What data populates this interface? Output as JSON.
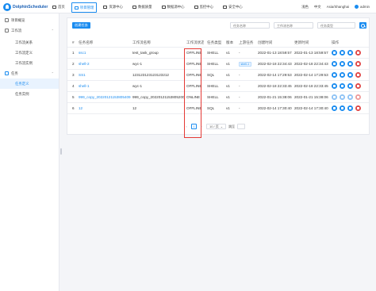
{
  "app": {
    "name": "DolphinScheduler"
  },
  "nav": [
    {
      "label": "首页",
      "active": false
    },
    {
      "label": "项目管理",
      "active": true
    },
    {
      "label": "资源中心",
      "active": false
    },
    {
      "label": "数据质量",
      "active": false
    },
    {
      "label": "数据源中心",
      "active": false
    },
    {
      "label": "监控中心",
      "active": false
    },
    {
      "label": "安全中心",
      "active": false
    }
  ],
  "header_right": {
    "theme": "浅色",
    "language": "中文",
    "timezone": "Asia/Shanghai",
    "user": "admin"
  },
  "sidebar": {
    "items": [
      {
        "label": "项目概览",
        "level": 0
      },
      {
        "label": "工作流",
        "level": 0,
        "expandable": true
      },
      {
        "label": "工作流关系",
        "level": 1
      },
      {
        "label": "工作流定义",
        "level": 1
      },
      {
        "label": "工作流实例",
        "level": 1
      },
      {
        "label": "任务",
        "level": 0,
        "expandable": true,
        "open": true
      },
      {
        "label": "任务定义",
        "level": 1,
        "active": true
      },
      {
        "label": "任务实例",
        "level": 1
      }
    ]
  },
  "toolbar": {
    "create_label": "创建任务",
    "filter_workflow_placeholder": "任务名称",
    "filter_name_placeholder": "工作流名称",
    "filter_type_placeholder": "任务类型"
  },
  "table": {
    "headers": [
      "#",
      "任务名称",
      "工作流名称",
      "工作流状态",
      "任务类型",
      "版本",
      "上游任务",
      "创建时间",
      "更新时间",
      "操作"
    ],
    "rows": [
      {
        "no": "1",
        "task": "ssc1",
        "workflow": "test_task_group",
        "status": "OFFLINE",
        "type": "SHELL",
        "version": "v1",
        "upstream": "-",
        "created": "2022-01-13 18:59:57",
        "updated": "2022-01-13 18:59:57",
        "ops_disabled": false
      },
      {
        "no": "2",
        "task": "shell-2",
        "workflow": "wyc-1",
        "status": "OFFLINE",
        "type": "SHELL",
        "version": "v1",
        "upstream": "shell-1",
        "created": "2022-02-18 22:34:43",
        "updated": "2022-02-18 22:34:43",
        "ops_disabled": false
      },
      {
        "no": "3",
        "task": "SS1",
        "workflow": "123123123123123212",
        "status": "OFFLINE",
        "type": "SQL",
        "version": "v1",
        "upstream": "-",
        "created": "2022-02-14 17:29:53",
        "updated": "2022-02-14 17:29:53",
        "ops_disabled": false
      },
      {
        "no": "4",
        "task": "shell-1",
        "workflow": "wyc-1",
        "status": "OFFLINE",
        "type": "SHELL",
        "version": "v1",
        "upstream": "-",
        "created": "2022-02-18 22:33:45",
        "updated": "2022-02-18 22:33:45",
        "ops_disabled": false
      },
      {
        "no": "5",
        "task": "999_copy_20220121153805409",
        "workflow": "999_copy_20220121153805200",
        "status": "ONLINE",
        "type": "SHELL",
        "version": "v1",
        "upstream": "-",
        "created": "2022-01-21 15:38:06",
        "updated": "2022-01-21 15:38:06",
        "ops_disabled": true
      },
      {
        "no": "6",
        "task": "12",
        "workflow": "12",
        "status": "OFFLINE",
        "type": "SQL",
        "version": "v1",
        "upstream": "-",
        "created": "2022-02-14 17:30:40",
        "updated": "2022-02-14 17:30:40",
        "ops_disabled": false
      }
    ]
  },
  "pagination": {
    "prev": "‹",
    "page": "1",
    "next": "›",
    "page_size": "10 / 页",
    "jump_label": "跳至"
  }
}
